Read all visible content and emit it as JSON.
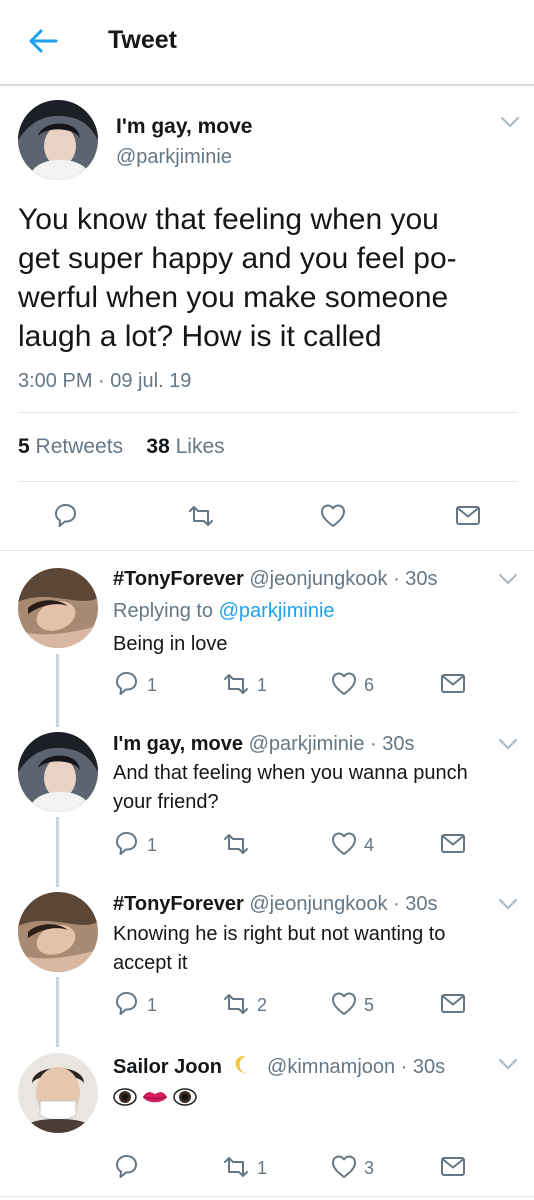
{
  "header": {
    "title": "Tweet"
  },
  "main_tweet": {
    "name": "I'm gay, move",
    "handle": "@parkjiminie",
    "text": "You know that feeling when you\nget super happy and you feel po-\nwerful when you make someone\nlaugh a lot? How is it called",
    "timestamp": "3:00 PM · 09 jul. 19",
    "retweets": "5",
    "retweets_label": "Retweets",
    "likes": "38",
    "likes_label": "Likes"
  },
  "replies": [
    {
      "name": "#TonyForever",
      "handle": "@jeonjungkook · 30s",
      "replying_prefix": "Replying to ",
      "replying_to": "@parkjiminie",
      "text": "Being in love",
      "replies": "1",
      "retweets": "1",
      "likes": "6"
    },
    {
      "name": "I'm gay, move",
      "handle": "@parkjiminie · 30s",
      "text": "And that feeling when you wanna punch\nyour friend?",
      "replies": "1",
      "retweets": "",
      "likes": "4"
    },
    {
      "name": "#TonyForever",
      "handle": "@jeonjungkook · 30s",
      "text": "Knowing he is right but not wanting to\naccept it",
      "replies": "1",
      "retweets": "2",
      "likes": "5"
    },
    {
      "name": "Sailor Joon",
      "handle": "@kimnamjoon · 30s",
      "text_emoji": "eye-lips-eye",
      "replies": "",
      "retweets": "1",
      "likes": "3"
    }
  ],
  "icons": [
    "back-arrow-icon",
    "chevron-down-icon",
    "reply-icon",
    "retweet-icon",
    "like-icon",
    "share-icon",
    "crescent-moon-icon"
  ],
  "colors": {
    "accent": "#1da1f2",
    "muted": "#657786",
    "border": "#e1e8ed",
    "text": "#14171a"
  }
}
